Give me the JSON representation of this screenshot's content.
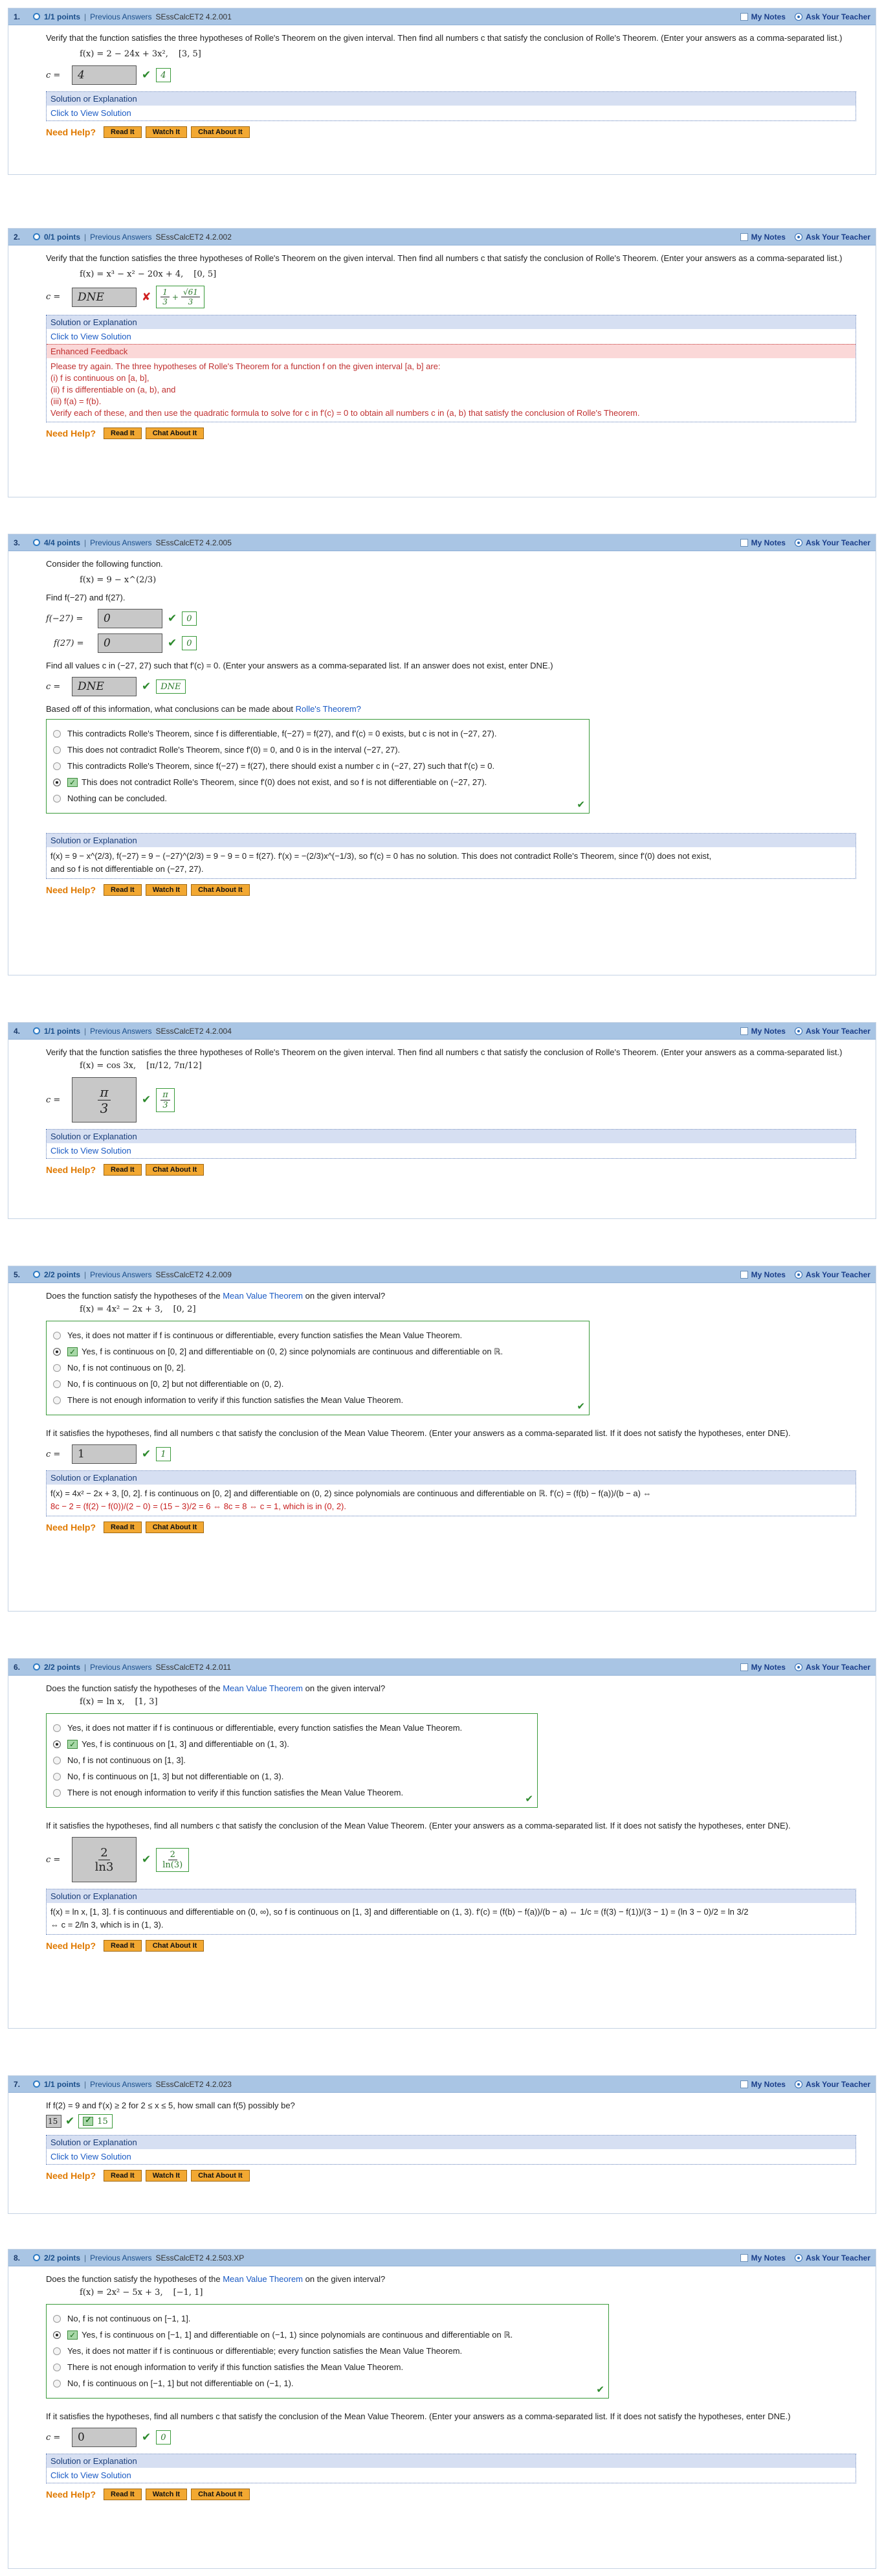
{
  "header_labels": {
    "my_notes": "My Notes",
    "ask": "Ask Your Teacher",
    "prev": "Previous Answers"
  },
  "help": {
    "title": "Need Help?",
    "read": "Read It",
    "watch": "Watch It",
    "chat": "Chat About It"
  },
  "sol_title": "Solution or Explanation",
  "sol_link": "Click to View Solution",
  "q1": {
    "num": "1.",
    "points": "1/1 points",
    "code": "SEssCalcET2 4.2.001",
    "prompt": "Verify that the function satisfies the three hypotheses of Rolle's Theorem on the given interval. Then find all numbers c that satisfy the conclusion of Rolle's Theorem. (Enter your answers as a comma-separated list.)",
    "formula": "f(x) = 2 − 24x + 3x²,",
    "interval": "[3, 5]",
    "label": "c =",
    "answer": "4",
    "key": "4"
  },
  "q2": {
    "num": "2.",
    "points": "0/1 points",
    "code": "SEssCalcET2 4.2.002",
    "prompt": "Verify that the function satisfies the three hypotheses of Rolle's Theorem on the given interval. Then find all numbers c that satisfy the conclusion of Rolle's Theorem. (Enter your answers as a comma-separated list.)",
    "formula": "f(x) = x³ − x² − 20x + 4,",
    "interval": "[0, 5]",
    "label": "c =",
    "answer": "DNE",
    "key_a": "1",
    "key_b": "3",
    "key_plus": "+",
    "key_root": "√61",
    "key_c": "3",
    "enh_title": "Enhanced Feedback",
    "enh_lines": [
      "Please try again. The three hypotheses of Rolle's Theorem for a function f on the given interval [a, b] are:",
      "(i) f is continuous on [a, b],",
      "(ii) f is differentiable on (a, b), and",
      "(iii) f(a) = f(b).",
      "Verify each of these, and then use the quadratic formula to solve for c in f'(c) = 0 to obtain all numbers c in (a, b) that satisfy the conclusion of Rolle's Theorem."
    ]
  },
  "q3": {
    "num": "3.",
    "points": "4/4 points",
    "code": "SEssCalcET2 4.2.005",
    "intro": "Consider the following function.",
    "formula": "f(x) = 9 − x^(2/3)",
    "find": "Find f(−27) and f(27).",
    "l1": "f(−27) =",
    "a1": "0",
    "k1": "0",
    "l2": "f(27) =",
    "a2": "0",
    "k2": "0",
    "find2": "Find all values c in (−27, 27) such that f'(c) = 0. (Enter your answers as a comma-separated list. If an answer does not exist, enter DNE.)",
    "l3": "c =",
    "a3": "DNE",
    "k3": "DNE",
    "based": "Based off of this information, what conclusions can be made about",
    "based_link": "Rolle's Theorem?",
    "options": [
      "This contradicts Rolle's Theorem, since f is differentiable, f(−27) = f(27), and f'(c) = 0 exists, but c is not in (−27, 27).",
      "This does not contradict Rolle's Theorem, since f'(0) = 0, and 0 is in the interval (−27, 27).",
      "This contradicts Rolle's Theorem, since f(−27) = f(27), there should exist a number c in (−27, 27) such that f'(c) = 0.",
      "This does not contradict Rolle's Theorem, since f'(0) does not exist, and so f is not differentiable on (−27, 27).",
      "Nothing can be concluded."
    ],
    "selected": 3,
    "sol_line1": "f(x) = 9 − x^(2/3), f(−27) = 9 − (−27)^(2/3) = 9 − 9 = 0 = f(27). f'(x) = −(2/3)x^(−1/3), so f'(c) = 0 has no solution. This does not contradict Rolle's Theorem, since f'(0) does not exist,",
    "sol_line2": "and so f is not differentiable on (−27, 27)."
  },
  "q4": {
    "num": "4.",
    "points": "1/1 points",
    "code": "SEssCalcET2 4.2.004",
    "prompt": "Verify that the function satisfies the three hypotheses of Rolle's Theorem on the given interval. Then find all numbers c that satisfy the conclusion of Rolle's Theorem. (Enter your answers as a comma-separated list.)",
    "formula": "f(x) = cos 3x,",
    "interval": "[π/12, 7π/12]",
    "label": "c =",
    "ans_n": "π",
    "ans_d": "3",
    "key_n": "π",
    "key_d": "3"
  },
  "q5": {
    "num": "5.",
    "points": "2/2 points",
    "code": "SEssCalcET2 4.2.009",
    "prompt": "Does the function satisfy the hypotheses of the",
    "prompt_link": "Mean Value Theorem",
    "prompt_end": "on the given interval?",
    "formula": "f(x) = 4x² − 2x + 3,",
    "interval": "[0, 2]",
    "options": [
      "Yes, it does not matter if f is continuous or differentiable, every function satisfies the Mean Value Theorem.",
      "Yes, f is continuous on [0, 2] and differentiable on (0, 2) since polynomials are continuous and differentiable on ℝ.",
      "No, f is not continuous on [0, 2].",
      "No, f is continuous on [0, 2] but not differentiable on (0, 2).",
      "There is not enough information to verify if this function satisfies the Mean Value Theorem."
    ],
    "selected": 1,
    "find": "If it satisfies the hypotheses, find all numbers c that satisfy the conclusion of the Mean Value Theorem. (Enter your answers as a comma-separated list. If it does not satisfy the hypotheses, enter DNE).",
    "label": "c =",
    "answer": "1",
    "key": "1",
    "sol_line1": "f(x) = 4x² − 2x + 3, [0, 2]. f is continuous on [0, 2] and differentiable on (0, 2) since polynomials are continuous and differentiable on ℝ. f'(c) = (f(b) − f(a))/(b − a) ⇔",
    "sol_line2": "8c − 2 = (f(2) − f(0))/(2 − 0) = (15 − 3)/2 = 6 ⇔ 8c = 8 ⇔ c = 1, which is in (0, 2)."
  },
  "q6": {
    "num": "6.",
    "points": "2/2 points",
    "code": "SEssCalcET2 4.2.011",
    "prompt": "Does the function satisfy the hypotheses of the",
    "prompt_link": "Mean Value Theorem",
    "prompt_end": "on the given interval?",
    "formula": "f(x) = ln x,",
    "interval": "[1, 3]",
    "options": [
      "Yes, it does not matter if f is continuous or differentiable, every function satisfies the Mean Value Theorem.",
      "Yes, f is continuous on [1, 3] and differentiable on (1, 3).",
      "No, f is not continuous on [1, 3].",
      "No, f is continuous on [1, 3] but not differentiable on (1, 3).",
      "There is not enough information to verify if this function satisfies the Mean Value Theorem."
    ],
    "selected": 1,
    "find": "If it satisfies the hypotheses, find all numbers c that satisfy the conclusion of the Mean Value Theorem. (Enter your answers as a comma-separated list. If it does not satisfy the hypotheses, enter DNE).",
    "label": "c =",
    "ans_n": "2",
    "ans_d": "ln3",
    "key_n": "2",
    "key_d": "ln(3)",
    "sol_line1": "f(x) = ln x, [1, 3]. f is continuous and differentiable on (0, ∞), so f is continuous on [1, 3] and differentiable on (1, 3). f'(c) = (f(b) − f(a))/(b − a) ⇔ 1/c = (f(3) − f(1))/(3 − 1) = (ln 3 − 0)/2 = ln 3/2",
    "sol_line2": "⇔ c = 2/ln 3, which is in (1, 3)."
  },
  "q7": {
    "num": "7.",
    "points": "1/1 points",
    "code": "SEssCalcET2 4.2.023",
    "prompt": "If f(2) = 9 and f'(x) ≥ 2 for 2 ≤ x ≤ 5, how small can f(5) possibly be?",
    "answer": "15",
    "key": "15"
  },
  "q8": {
    "num": "8.",
    "points": "2/2 points",
    "code": "SEssCalcET2 4.2.503.XP",
    "prompt": "Does the function satisfy the hypotheses of the",
    "prompt_link": "Mean Value Theorem",
    "prompt_end": "on the given interval?",
    "formula": "f(x) = 2x² − 5x + 3,",
    "interval": "[−1, 1]",
    "options": [
      "No, f is not continuous on [−1, 1].",
      "Yes, f is continuous on [−1, 1] and differentiable on (−1, 1) since polynomials are continuous and differentiable on ℝ.",
      "Yes, it does not matter if f is continuous or differentiable; every function satisfies the Mean Value Theorem.",
      "There is not enough information to verify if this function satisfies the Mean Value Theorem.",
      "No, f is continuous on [−1, 1] but not differentiable on (−1, 1)."
    ],
    "selected": 1,
    "find": "If it satisfies the hypotheses, find all numbers c that satisfy the conclusion of the Mean Value Theorem. (Enter your answers as a comma-separated list. If it does not satisfy the hypotheses, enter DNE.)",
    "label": "c =",
    "answer": "0",
    "key": "0"
  }
}
